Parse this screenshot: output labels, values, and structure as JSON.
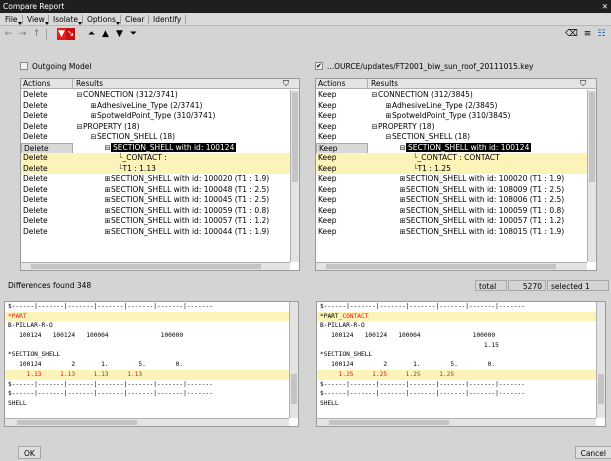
{
  "window": {
    "title": "Compare Report",
    "close": "✕"
  },
  "menu": [
    {
      "label": "File"
    },
    {
      "label": "View"
    },
    {
      "label": "Isolate"
    },
    {
      "label": "Options"
    },
    {
      "label": "Clear"
    },
    {
      "label": "Identify"
    }
  ],
  "toolbar": {
    "back_icon": "←",
    "forward_icon": "→",
    "up_icon": "↑",
    "filter_icon": "▼",
    "first_icon": "⏶",
    "prev_icon": "▲",
    "next_icon": "▼",
    "last_icon": "⏷",
    "erase_icon": "⌫",
    "list_icon": "≡",
    "list2_icon": "☷"
  },
  "left": {
    "header_label": "Outgoing Model",
    "checked": false,
    "col_actions": "Actions",
    "col_results": "Results",
    "rows": [
      {
        "action": "Delete",
        "label": "CONNECTION (312/3741)",
        "level": 0,
        "exp": "⊟"
      },
      {
        "action": "Delete",
        "label": "AdhesiveLine_Type (2/3741)",
        "level": 1,
        "exp": "⊞"
      },
      {
        "action": "Delete",
        "label": "SpotweldPoint_Type (310/3741)",
        "level": 1,
        "exp": "⊞"
      },
      {
        "action": "Delete",
        "label": "PROPERTY (18)",
        "level": 0,
        "exp": "⊟"
      },
      {
        "action": "Delete",
        "label": "SECTION_SHELL (18)",
        "level": 1,
        "exp": "⊟"
      },
      {
        "action": "Delete",
        "label": "SECTION_SHELL with id: 100124",
        "level": 2,
        "exp": "⊟",
        "selected": true,
        "current": true
      },
      {
        "action": "Delete",
        "label": "_CONTACT :",
        "level": 3,
        "exp": "",
        "hl": true
      },
      {
        "action": "Delete",
        "label": "T1 : 1.13",
        "level": 3,
        "exp": "",
        "hl": true
      },
      {
        "action": "Delete",
        "label": "SECTION_SHELL with id: 100020 (T1 : 1.9)",
        "level": 2,
        "exp": "⊞"
      },
      {
        "action": "Delete",
        "label": "SECTION_SHELL with id: 100048 (T1 : 2.5)",
        "level": 2,
        "exp": "⊞"
      },
      {
        "action": "Delete",
        "label": "SECTION_SHELL with id: 100045 (T1 : 2.5)",
        "level": 2,
        "exp": "⊞"
      },
      {
        "action": "Delete",
        "label": "SECTION_SHELL with id: 100059 (T1 : 0.8)",
        "level": 2,
        "exp": "⊞"
      },
      {
        "action": "Delete",
        "label": "SECTION_SHELL with id: 100057 (T1 : 1.2)",
        "level": 2,
        "exp": "⊞"
      },
      {
        "action": "Delete",
        "label": "SECTION_SHELL with id: 100044 (T1 : 1.9)",
        "level": 2,
        "exp": "⊞"
      }
    ],
    "text_lines": [
      {
        "t": "$------|-------|-------|-------|-------|-------|-------",
        "hl": false
      },
      {
        "t": "*PART",
        "hl": true,
        "red": true
      },
      {
        "t": "B-PILLAR-R-O",
        "hl": false
      },
      {
        "t": "   100124   100124   100004              100000",
        "hl": false
      },
      {
        "t": "",
        "hl": false
      },
      {
        "t": "*SECTION_SHELL",
        "hl": false
      },
      {
        "t": "   100124        2       1.        5.        0.",
        "hl": false
      },
      {
        "t": "     1.13     1.13     1.13     1.13",
        "hl": true,
        "red": true
      },
      {
        "t": "$------|-------|-------|-------|-------|-------|-------",
        "hl": false
      },
      {
        "t": "$------|-------|-------|-------|-------|-------|-------",
        "hl": false
      },
      {
        "t": "SHELL",
        "hl": false
      }
    ]
  },
  "right": {
    "header_label": "...OURCE/updates/FT2001_biw_sun_roof_20111015.key",
    "checked": true,
    "col_actions": "Actions",
    "col_results": "Results",
    "rows": [
      {
        "action": "Keep",
        "label": "CONNECTION (312/3845)",
        "level": 0,
        "exp": "⊟"
      },
      {
        "action": "Keep",
        "label": "AdhesiveLine_Type (2/3845)",
        "level": 1,
        "exp": "⊞"
      },
      {
        "action": "Keep",
        "label": "SpotweldPoint_Type (310/3845)",
        "level": 1,
        "exp": "⊞"
      },
      {
        "action": "Keep",
        "label": "PROPERTY (18)",
        "level": 0,
        "exp": "⊟"
      },
      {
        "action": "Keep",
        "label": "SECTION_SHELL (18)",
        "level": 1,
        "exp": "⊟"
      },
      {
        "action": "Keep",
        "label": "SECTION_SHELL with id: 100124",
        "level": 2,
        "exp": "⊟",
        "selected": true,
        "current": true
      },
      {
        "action": "Keep",
        "label": "_CONTACT : CONTACT",
        "level": 3,
        "exp": "",
        "hl": true
      },
      {
        "action": "Keep",
        "label": "T1 : 1.25",
        "level": 3,
        "exp": "",
        "hl": true
      },
      {
        "action": "Keep",
        "label": "SECTION_SHELL with id: 100020 (T1 : 1.9)",
        "level": 2,
        "exp": "⊞"
      },
      {
        "action": "Keep",
        "label": "SECTION_SHELL with id: 108009 (T1 : 2.5)",
        "level": 2,
        "exp": "⊞"
      },
      {
        "action": "Keep",
        "label": "SECTION_SHELL with id: 108006 (T1 : 2.5)",
        "level": 2,
        "exp": "⊞"
      },
      {
        "action": "Keep",
        "label": "SECTION_SHELL with id: 100059 (T1 : 0.8)",
        "level": 2,
        "exp": "⊞"
      },
      {
        "action": "Keep",
        "label": "SECTION_SHELL with id: 100057 (T1 : 1.2)",
        "level": 2,
        "exp": "⊞"
      },
      {
        "action": "Keep",
        "label": "SECTION_SHELL with id: 108015 (T1 : 1.9)",
        "level": 2,
        "exp": "⊞"
      }
    ],
    "text_lines": [
      {
        "t": "$------|-------|-------|-------|-------|-------|-------",
        "hl": false
      },
      {
        "t": "*PART_",
        "hl": true,
        "red": false,
        "suffix": "CONTACT"
      },
      {
        "t": "B-PILLAR-R-O",
        "hl": false
      },
      {
        "t": "   100124   100124   100004              100000",
        "hl": false
      },
      {
        "t": "                                            1.15",
        "hl": false
      },
      {
        "t": "*SECTION_SHELL",
        "hl": false
      },
      {
        "t": "   100124        2       1.        5.        0.",
        "hl": false
      },
      {
        "t": "     1.25     1.25     1.25     1.25",
        "hl": true,
        "red": true
      },
      {
        "t": "$------|-------|-------|-------|-------|-------|-------",
        "hl": false
      },
      {
        "t": "$------|-------|-------|-------|-------|-------|-------",
        "hl": false
      },
      {
        "t": "SHELL",
        "hl": false
      }
    ]
  },
  "status": {
    "differences": "Differences found 348",
    "total_label": "total",
    "total_value": "5270",
    "selected": "selected 1"
  },
  "buttons": {
    "ok": "OK",
    "cancel": "Cancel"
  },
  "colors": {
    "highlight": "#fbf3b8",
    "accent_red": "#e01a1a",
    "selection": "#000000"
  }
}
